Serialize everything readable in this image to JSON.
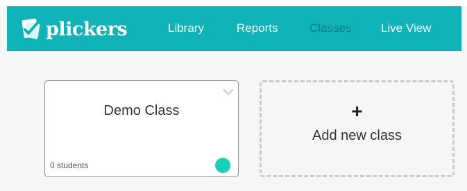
{
  "brand": {
    "name": "plickers"
  },
  "nav": {
    "items": [
      {
        "label": "Library",
        "active": false
      },
      {
        "label": "Reports",
        "active": false
      },
      {
        "label": "Classes",
        "active": true
      },
      {
        "label": "Live View",
        "active": false
      }
    ]
  },
  "classes": [
    {
      "title": "Demo Class",
      "count": "0 students",
      "color": "#15d1b6"
    }
  ],
  "add_class": {
    "icon": "plus-icon",
    "label": "Add new class"
  },
  "theme": {
    "accent": "#10b4b8",
    "active_nav": "#0e7f86"
  },
  "icons": {
    "brand": "plickers-card-check-icon",
    "chevron": "chevron-down-icon"
  }
}
